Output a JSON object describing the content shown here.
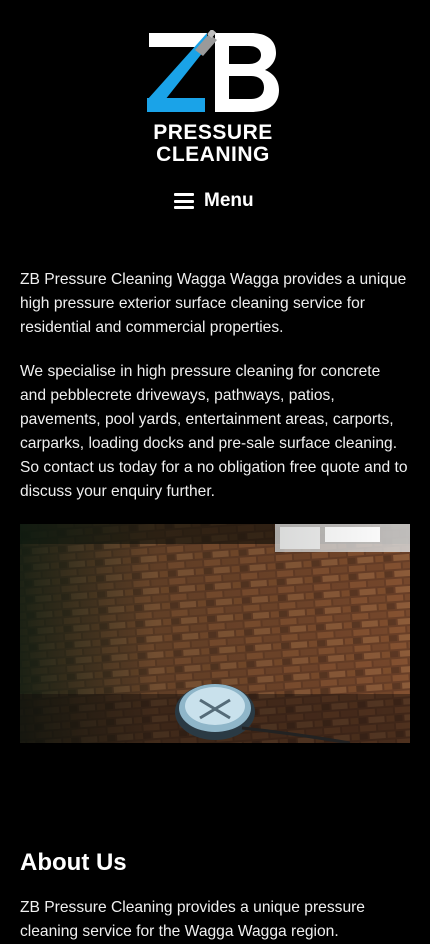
{
  "header": {
    "logo": {
      "mark_letters": "ZB",
      "line1": "PRESSURE",
      "line2": "CLEANING",
      "accent_color": "#1aa3e8"
    },
    "menu_label": "Menu"
  },
  "intro": {
    "paragraph1": "ZB Pressure Cleaning Wagga Wagga provides a unique high pressure exterior surface cleaning service for residential and commercial properties.",
    "paragraph2": "We specialise in high pressure cleaning for concrete and pebblecrete driveways, pathways, patios, pavements, pool yards, entertainment areas, carports, carparks, loading docks and pre-sale surface cleaning. So contact us today for a no obligation free quote and to discuss your enquiry further."
  },
  "about": {
    "heading": "About Us",
    "paragraph": "ZB Pressure Cleaning provides a unique pressure cleaning service for the Wagga Wagga region."
  },
  "colors": {
    "background": "#000000",
    "text": "#ffffff",
    "brand_blue": "#1aa3e8"
  }
}
